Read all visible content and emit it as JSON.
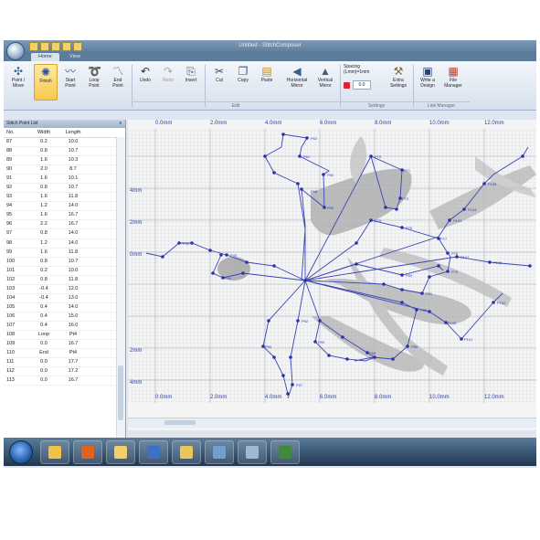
{
  "app": {
    "title": "Untitled - StitchComposer",
    "tabs": [
      {
        "label": "Home"
      },
      {
        "label": "View"
      }
    ]
  },
  "ribbon": {
    "buttons": [
      {
        "label": "Point /\nMove",
        "icon": "point-move-icon"
      },
      {
        "label": "Finish",
        "icon": "finish-icon"
      },
      {
        "label": "Start\nPoint",
        "icon": "start-point-icon"
      },
      {
        "label": "Loop\nPoint",
        "icon": "loop-point-icon"
      },
      {
        "label": "End\nPoint",
        "icon": "end-point-icon"
      },
      {
        "label": "Undo",
        "icon": "undo-icon"
      },
      {
        "label": "Redo",
        "icon": "redo-icon"
      },
      {
        "label": "Insert",
        "icon": "insert-icon"
      },
      {
        "label": "Cut",
        "icon": "cut-icon"
      },
      {
        "label": "Copy",
        "icon": "copy-icon"
      },
      {
        "label": "Paste",
        "icon": "paste-icon"
      },
      {
        "label": "Horizontal\nMirror",
        "icon": "horizontal-mirror-icon"
      },
      {
        "label": "Vertical\nMirror",
        "icon": "vertical-mirror-icon"
      },
      {
        "label": "Extra\nSettings",
        "icon": "extra-settings-icon"
      },
      {
        "label": "Write a\nDesign",
        "icon": "write-design-icon"
      },
      {
        "label": "File\nManager",
        "icon": "file-manager-icon"
      }
    ],
    "spacing_label": "Spacing\n(Lmm)=1mm",
    "spacing_value": "0.0",
    "groups": [
      {
        "label": "Edit"
      },
      {
        "label": "Settings"
      },
      {
        "label": "Link Manager"
      }
    ]
  },
  "panel": {
    "title": "Stitch Point List",
    "close": "x",
    "headers": [
      "No.",
      "Width",
      "Length"
    ],
    "rows": [
      [
        "87",
        "0.2",
        "10.0"
      ],
      [
        "88",
        "0.8",
        "10.7"
      ],
      [
        "89",
        "1.6",
        "10.3"
      ],
      [
        "90",
        "2.0",
        "8.7"
      ],
      [
        "91",
        "1.6",
        "10.1"
      ],
      [
        "92",
        "0.8",
        "10.7"
      ],
      [
        "93",
        "1.6",
        "11.8"
      ],
      [
        "94",
        "1.2",
        "14.0"
      ],
      [
        "95",
        "1.6",
        "16.7"
      ],
      [
        "96",
        "2.2",
        "16.7"
      ],
      [
        "97",
        "0.8",
        "14.0"
      ],
      [
        "98",
        "1.2",
        "14.0"
      ],
      [
        "99",
        "1.6",
        "11.8"
      ],
      [
        "100",
        "0.8",
        "10.7"
      ],
      [
        "101",
        "0.2",
        "10.0"
      ],
      [
        "102",
        "0.8",
        "11.8"
      ],
      [
        "103",
        "-0.4",
        "12.0"
      ],
      [
        "104",
        "-0.4",
        "13.0"
      ],
      [
        "105",
        "0.4",
        "14.0"
      ],
      [
        "106",
        "0.4",
        "15.0"
      ],
      [
        "107",
        "0.4",
        "16.0"
      ],
      [
        "108",
        "Loop",
        "Pt4"
      ],
      [
        "109",
        "0.0",
        "16.7"
      ],
      [
        "110",
        "End",
        "Pt4"
      ],
      [
        "111",
        "0.0",
        "17.7"
      ],
      [
        "112",
        "0.0",
        "17.2"
      ],
      [
        "113",
        "0.0",
        "16.7"
      ]
    ]
  },
  "canvas": {
    "ruler_top": [
      "0.0mm",
      "2.0mm",
      "4.0mm",
      "6.0mm",
      "8.0mm",
      "10.0mm",
      "12.0mm"
    ],
    "ruler_bottom": [
      "0.0mm",
      "2.0mm",
      "4.0mm",
      "6.0mm",
      "8.0mm",
      "10.0mm",
      "12.0mm"
    ],
    "ruler_left": [
      "4mm",
      "2mm",
      "0mm",
      "2mm",
      "4mm"
    ]
  },
  "taskbar": {
    "items": [
      {
        "icon": "outlook-icon",
        "color": "#f0c24a"
      },
      {
        "icon": "firefox-icon",
        "color": "#e0641f"
      },
      {
        "icon": "explorer-folder-icon",
        "color": "#f2cf68"
      },
      {
        "icon": "word-icon",
        "color": "#3d6fc2"
      },
      {
        "icon": "folder-icon",
        "color": "#e8c65a"
      },
      {
        "icon": "network-icon",
        "color": "#6fa0cf"
      },
      {
        "icon": "stitch-app-icon",
        "color": "#9fb6d4"
      },
      {
        "icon": "media-icon",
        "color": "#3e8a3a"
      }
    ]
  }
}
